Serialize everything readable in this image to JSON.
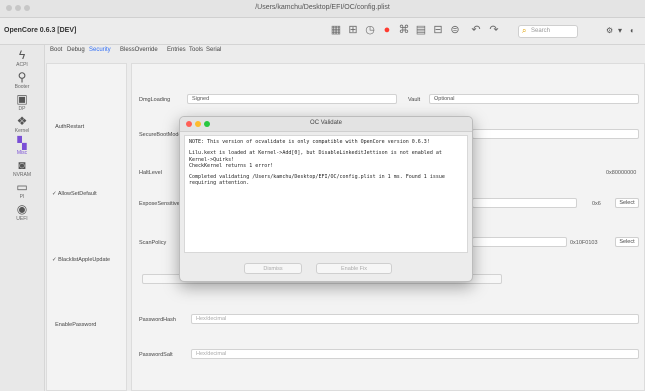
{
  "window": {
    "title": "/Users/kamchu/Desktop/EFI/OC/config.plist"
  },
  "toolbar": {
    "app_name": "OpenCore 0.6.3 [DEV]",
    "search_placeholder": "Search",
    "icons": [
      "qr-icon",
      "grid-icon",
      "clock-icon",
      "error-icon",
      "code-icon",
      "save-icon",
      "database-icon",
      "database-alt-icon",
      "undo-icon",
      "redo-icon"
    ]
  },
  "sidebar": {
    "items": [
      {
        "label": "ACPI",
        "icon": "acpi-icon"
      },
      {
        "label": "Booter",
        "icon": "booter-icon"
      },
      {
        "label": "DP",
        "icon": "device-properties-icon"
      },
      {
        "label": "Kernel",
        "icon": "kernel-icon"
      },
      {
        "label": "Misc",
        "icon": "misc-icon",
        "active": true
      },
      {
        "label": "NVRAM",
        "icon": "nvram-icon"
      },
      {
        "label": "PI",
        "icon": "platforminfo-icon"
      },
      {
        "label": "UEFI",
        "icon": "uefi-icon"
      }
    ]
  },
  "tabs": [
    "Boot",
    "Debug",
    "Security",
    "BlessOverride",
    "Entries",
    "Tools",
    "Serial"
  ],
  "active_tab": "Security",
  "security": {
    "checkboxes": [
      {
        "label": "AuthRestart",
        "checked": false
      },
      {
        "label": "AllowSetDefault",
        "checked": true
      },
      {
        "label": "BlacklistAppleUpdate",
        "checked": true
      },
      {
        "label": "EnablePassword",
        "checked": false
      }
    ],
    "dmg_loading_label": "DmgLoading",
    "dmg_loading_value": "Signed",
    "vault_label": "Vault",
    "vault_value": "Optional",
    "secure_boot_model_label": "SecureBootModel",
    "halt_level_label": "HaltLevel",
    "halt_level_value": "0x80000000",
    "expose_sensitive_data_label": "ExposeSensitiveData",
    "expose_sensitive_data_value": "0x6",
    "scan_policy_label": "ScanPolicy",
    "scan_policy_value": "0x10F0103",
    "select_label": "Select",
    "password_hash_label": "PasswordHash",
    "password_hash_placeholder": "Hex/decimal",
    "password_salt_label": "PasswordSalt",
    "password_salt_placeholder": "Hex/decimal"
  },
  "dialog": {
    "title": "OC Validate",
    "line1": "NOTE: This version of ocvalidate is only compatible with OpenCore version 0.6.3!",
    "line2": "Lilu.kext is loaded at Kernel->Add[0], but DisableLinkeditJettison is not enabled at Kernel->Quirks!",
    "line3": "CheckKernel returns 1 error!",
    "line4": "Completed validating /Users/kamchu/Desktop/EFI/OC/config.plist in 1 ms. Found 1 issue requiring attention.",
    "button_dismiss": "Dismiss",
    "button_fix": "Enable Fix"
  },
  "colors": {
    "accent": "#2f6df6",
    "active_sidebar": "#7a4fd6",
    "error": "#ff3b30"
  }
}
